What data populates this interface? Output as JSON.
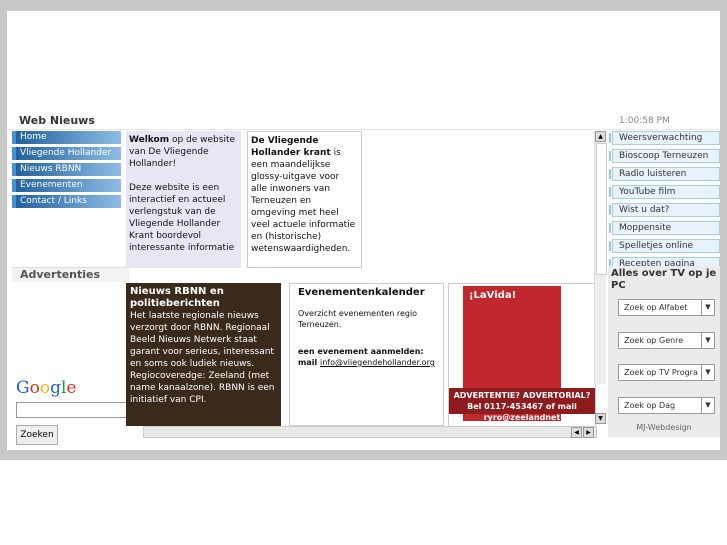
{
  "header": {
    "title": "Web Nieuws",
    "clock": "1:00:58 PM"
  },
  "left_nav": [
    "Home",
    "Vliegende Hollander",
    "Nieuws RBNN",
    "Evenementen",
    "Contact / Links"
  ],
  "advertenties": "Advertenties",
  "google": {
    "logo": "Google",
    "search_button": "Zoeken"
  },
  "welkom": {
    "bold": "Welkom",
    "text": " op de website van De Vliegende Hollander!",
    "text2": "Deze website is een interactief en actueel verlengstuk van de Vliegende Hollander Krant boordevol interessante informatie"
  },
  "krant": {
    "bold": "De Vliegende Hollander krant",
    "text": " is een maandelijkse glossy-uitgave voor alle inwoners van Terneuzen en omgeving met heel veel actuele informatie en (historische) wetenswaardigheden."
  },
  "rbnn": {
    "title": "Nieuws RBNN en politieberichten",
    "text": "Het laatste regionale nieuws verzorgt door RBNN. Regionaal Beeld Nieuws Netwerk staat garant voor serieus, interessant en soms ook ludiek nieuws. Regiocoveredge: Zeeland (met name kanaalzone). RBNN is een initiatief van CPI."
  },
  "events": {
    "title": "Evenementenkalender",
    "line1": "Overzicht evenementen regio Terneuzen.",
    "line2": "een evenement aanmelden:",
    "mail_label": "mail ",
    "mail": "info@vliegendehollander.org"
  },
  "ad": {
    "mag_title": "¡LaVida!",
    "line1": "ADVERTENTIE?  ADVERTORIAL?",
    "line2": "Bel 0117-453467 of mail  ryro@zeelandnet"
  },
  "right_nav": [
    "Weersverwachting",
    "Bioscoop Terneuzen",
    "Radio luisteren",
    "YouTube film",
    "Wist u dat?",
    "Moppensite",
    "Spelletjes online",
    "Recepten pagina"
  ],
  "tv": {
    "title": "Alles over TV op je PC",
    "selects": [
      "Zoek op Alfabet",
      "Zoek op Genre",
      "Zoek op TV Progra",
      "Zoek op Dag"
    ],
    "credit": "MJ-Webdesign"
  }
}
